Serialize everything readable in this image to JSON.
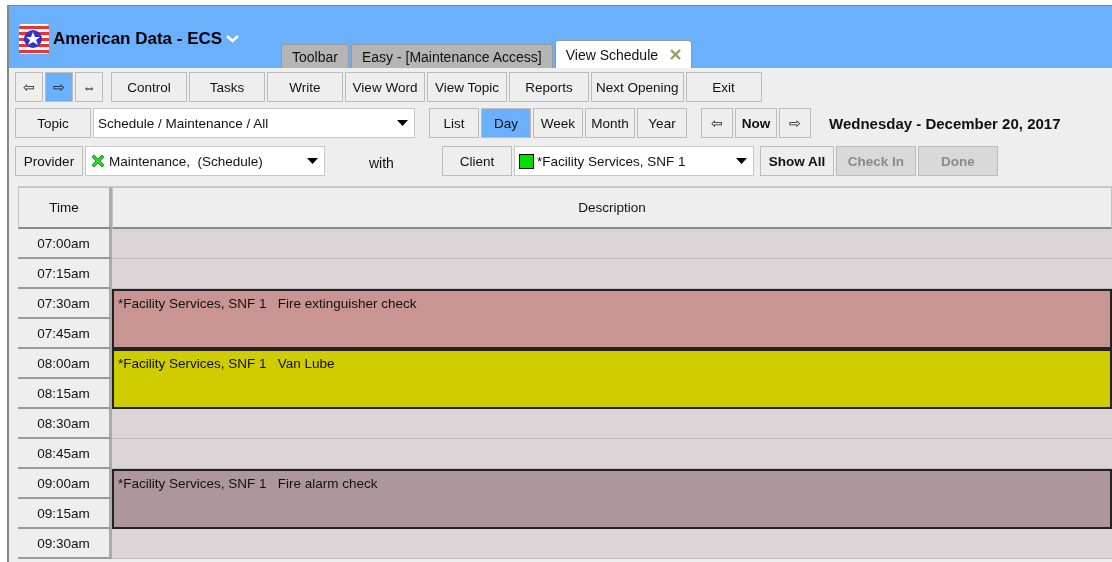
{
  "app": {
    "title": "American Data - ECS"
  },
  "tabs": [
    {
      "label": "Toolbar",
      "selected": false
    },
    {
      "label": "Easy - [Maintenance Access]",
      "selected": false
    },
    {
      "label": "View Schedule",
      "selected": true,
      "closable": true
    }
  ],
  "nav_buttons": [
    {
      "label": "⇦",
      "selected": false
    },
    {
      "label": "⇨",
      "selected": true
    },
    {
      "label": "⇔",
      "selected": false
    }
  ],
  "menu_buttons": [
    "Control",
    "Tasks",
    "Write",
    "View Word",
    "View Topic",
    "Reports",
    "Next Opening",
    "Exit"
  ],
  "topic": {
    "button": "Topic",
    "value": "Schedule / Maintenance / All"
  },
  "view_buttons": [
    {
      "label": "List",
      "selected": false
    },
    {
      "label": "Day",
      "selected": true
    },
    {
      "label": "Week",
      "selected": false
    },
    {
      "label": "Month",
      "selected": false
    },
    {
      "label": "Year",
      "selected": false
    }
  ],
  "date_nav": {
    "previous": "⇦",
    "now": "Now",
    "next": "⇨"
  },
  "date": "Wednesday - December 20, 2017",
  "provider": {
    "button": "Provider",
    "value": "Maintenance,  (Schedule)"
  },
  "with_label": "with",
  "client": {
    "button": "Client",
    "value": "*Facility Services, SNF 1"
  },
  "actions": [
    {
      "label": "Show All",
      "disabled": false
    },
    {
      "label": "Check In",
      "disabled": true
    },
    {
      "label": "Done",
      "disabled": true
    }
  ],
  "table": {
    "columns": [
      "Time",
      "Description"
    ],
    "blocks": [
      {
        "times": [
          "07:00am"
        ]
      },
      {
        "times": [
          "07:15am"
        ]
      },
      {
        "times": [
          "07:30am",
          "07:45am"
        ],
        "event": {
          "client": "*Facility Services, SNF 1",
          "task": "Fire extinguisher check",
          "color": "#c99593"
        }
      },
      {
        "times": [
          "08:00am",
          "08:15am"
        ],
        "event": {
          "client": "*Facility Services, SNF 1",
          "task": "Van Lube",
          "color": "#cfcc00"
        }
      },
      {
        "times": [
          "08:30am"
        ]
      },
      {
        "times": [
          "08:45am"
        ]
      },
      {
        "times": [
          "09:00am",
          "09:15am"
        ],
        "event": {
          "client": "*Facility Services, SNF 1",
          "task": "Fire alarm check",
          "color": "#ad979c"
        }
      },
      {
        "times": [
          "09:30am"
        ]
      }
    ]
  }
}
